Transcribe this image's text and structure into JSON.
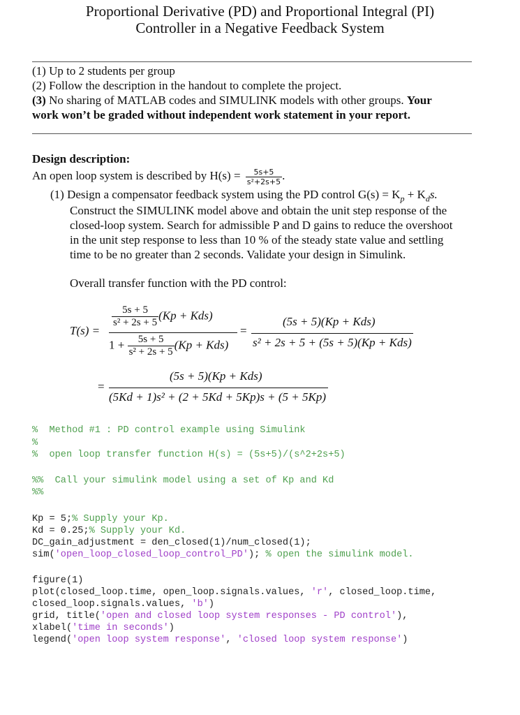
{
  "header": {
    "title_line1": "Proportional Derivative (PD) and Proportional Integral (PI)",
    "title_line2": "Controller in a Negative Feedback System"
  },
  "rules": {
    "item1": "(1) Up to 2 students per group",
    "item2": "(2) Follow the description in the handout to complete the project.",
    "item3_num": "(3)",
    "item3_text": " No sharing of MATLAB codes and SIMULINK models with other groups. ",
    "item3_bold_a": "Your",
    "item3_bold_b": "work won’t be graded without independent work statement in your report."
  },
  "design": {
    "heading": "Design description:",
    "intro": "An open loop system is described by H(s) =",
    "h_num": "5s+5",
    "h_den": "s²+2s+5",
    "h_end": ".",
    "task1_line1": "(1) Design a compensator feedback system using the PD control  G(s) = K",
    "task1_p": "p",
    "task1_plus": " + K",
    "task1_d": "d",
    "task1_s": "s.",
    "task1_lines": [
      "Construct the SIMULINK model above and obtain the unit step response of the",
      "closed-loop system.  Search for admissible P and D gains to reduce the overshoot",
      "in the unit step response to less than 10 % of the steady state value and settling",
      "time to be no greater than 2 seconds.  Validate your design in Simulink."
    ],
    "overall_label": "Overall transfer function with the PD control:"
  },
  "equation": {
    "lhs": "T(s) =",
    "frac1_inner_num": "5s + 5",
    "frac1_inner_den": "s² + 2s + 5",
    "gain": "(Kp + Kds)",
    "one_plus": "1 +",
    "eq": "=",
    "rhs_num": "(5s + 5)(Kp + Kds)",
    "rhs_den": "s² + 2s + 5 + (5s + 5)(Kp + Kds)",
    "final_num": "(5s + 5)(Kp + Kds)",
    "final_den": "(5Kd + 1)s² + (2 + 5Kd + 5Kp)s + (5 + 5Kp)"
  },
  "code": {
    "comments1": [
      "%  Method #1 : PD control example using Simulink",
      "%",
      "%  open loop transfer function H(s) = (5s+5)/(s^2+2s+5)"
    ],
    "comments2": [
      "%%  Call your simulink model using a set of Kp and Kd",
      "%%"
    ],
    "kp_code": "Kp = 5;",
    "kp_comment": "% Supply your Kp.",
    "kd_code": "Kd = 0.25;",
    "kd_comment": "% Supply your Kd.",
    "dc_line": "DC_gain_adjustment = den_closed(1)/num_closed(1);",
    "sim_a": "sim(",
    "sim_str": "'open_loop_closed_loop_control_PD'",
    "sim_b": "); ",
    "sim_comment": "% open the simulink model.",
    "fig_line": "figure(1)",
    "plot_a": "plot(closed_loop.time, open_loop.signals.values, ",
    "plot_r": "'r'",
    "plot_b": ", closed_loop.time,",
    "plot2_a": "closed_loop.signals.values, ",
    "plot2_b": "'b'",
    "plot2_c": ")",
    "grid_a": "grid, title(",
    "grid_str": "'open and closed loop system responses - PD control'",
    "grid_b": "),",
    "xl_a": "xlabel(",
    "xl_str": "'time in seconds'",
    "xl_b": ")",
    "lg_a": "legend(",
    "lg_str1": "'open loop system response'",
    "lg_sep": ", ",
    "lg_str2": "'closed loop system response'",
    "lg_b": ")"
  }
}
